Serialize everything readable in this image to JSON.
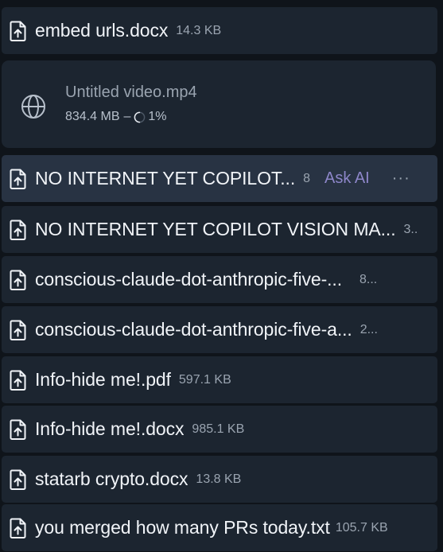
{
  "downloads": {
    "top_item": {
      "name": "embed urls.docx",
      "size": "14.3 KB",
      "icon": "file-download-icon"
    },
    "in_progress": {
      "name": "Untitled video.mp4",
      "downloaded": "834.4 MB",
      "separator": "–",
      "percent": "1%",
      "progress_fraction": 0.01,
      "icon": "globe-icon"
    },
    "items": [
      {
        "name": "NO INTERNET YET COPILOT...",
        "size": "8",
        "ask_ai": "Ask AI",
        "more": "···",
        "icon": "file-download-icon"
      },
      {
        "name": "NO INTERNET YET COPILOT VISION MA...",
        "size": "3..",
        "icon": "file-download-icon"
      },
      {
        "name": "conscious-claude-dot-anthropic-five-...",
        "size": "8...",
        "icon": "file-download-icon"
      },
      {
        "name": "conscious-claude-dot-anthropic-five-a...",
        "size": "2...",
        "icon": "file-download-icon"
      },
      {
        "name": "Info-hide me!.pdf",
        "size": "597.1 KB",
        "icon": "file-download-icon"
      },
      {
        "name": "Info-hide me!.docx",
        "size": "985.1 KB",
        "icon": "file-download-icon"
      },
      {
        "name": "statarb crypto.docx",
        "size": "13.8 KB",
        "icon": "file-download-icon"
      },
      {
        "name": "you merged how many PRs today.txt",
        "size": "105.7 KB",
        "icon": "file-download-icon"
      }
    ]
  }
}
